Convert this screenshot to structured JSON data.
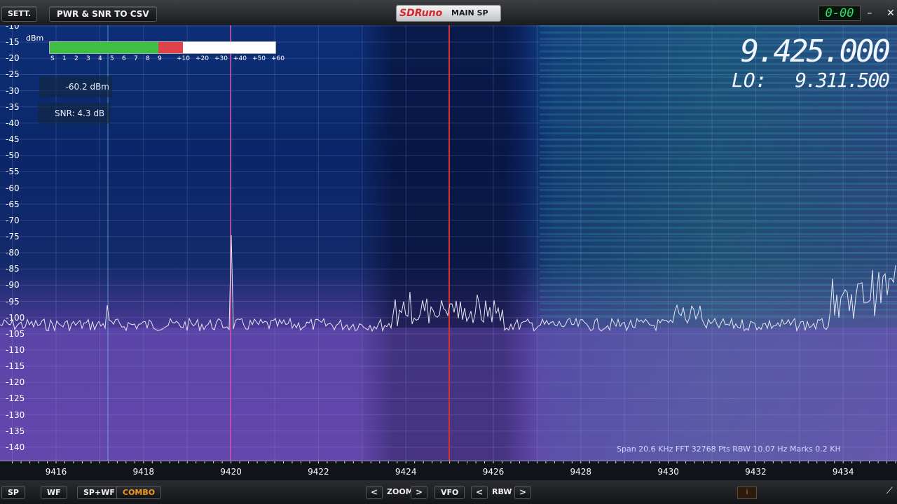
{
  "titlebar": {
    "settings_label": "SETT.",
    "export_label": "PWR & SNR TO CSV",
    "logo": "SDRuno",
    "window_title": "MAIN SP",
    "clock": "0-00",
    "minimize": "–",
    "close": "✕"
  },
  "meter": {
    "unit": "dBm",
    "scale_labels": [
      "S",
      "1",
      "2",
      "3",
      "4",
      "5",
      "6",
      "7",
      "8",
      "9",
      "+10",
      "+20",
      "+30",
      "+40",
      "+50",
      "+60"
    ],
    "power_readout": "-60.2 dBm",
    "snr_readout": "SNR: 4.3 dB",
    "green_fraction": 0.48,
    "red_fraction": 0.11
  },
  "frequency": {
    "main": "9.425.000",
    "lo_label": "LO:",
    "lo_value": "9.311.500"
  },
  "y_axis_labels": [
    "-10",
    "-15",
    "-20",
    "-25",
    "-30",
    "-35",
    "-40",
    "-45",
    "-50",
    "-55",
    "-60",
    "-65",
    "-70",
    "-75",
    "-80",
    "-85",
    "-90",
    "-95",
    "-100",
    "-105",
    "-110",
    "-115",
    "-120",
    "-125",
    "-130",
    "-135",
    "-140"
  ],
  "x_axis_labels": [
    "9416",
    "9418",
    "9420",
    "9422",
    "9424",
    "9426",
    "9428",
    "9430",
    "9432",
    "9434"
  ],
  "status_line": "Span 20.6 KHz   FFT 32768 Pts   RBW 10.07 Hz   Marks 0.2 KH",
  "bottombar": {
    "sp": "SP",
    "wf": "WF",
    "spwf": "SP+WF",
    "combo": "COMBO",
    "zoom_left": "<",
    "zoom": "ZOOM",
    "zoom_right": ">",
    "vfo": "VFO",
    "rbw_left": "<",
    "rbw": "RBW",
    "rbw_right": ">",
    "info": "i"
  },
  "colors": {
    "accent_red": "#e0424b",
    "meter_green": "#3fbf43",
    "combo_active": "#f29b1b",
    "clock_green": "#28e36b"
  }
}
